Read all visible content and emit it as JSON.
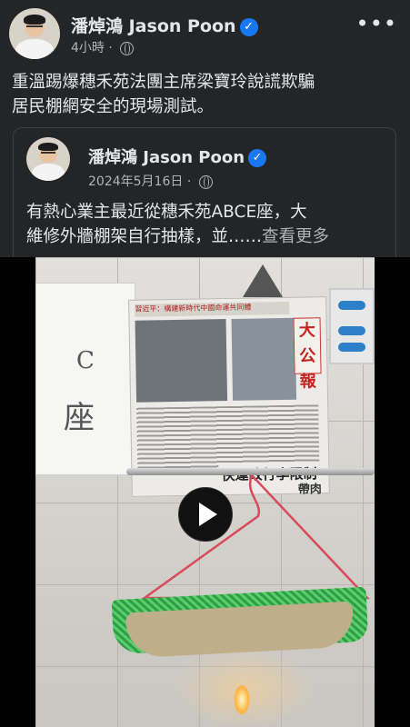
{
  "post": {
    "author": "潘焯鴻 Jason Poon",
    "verified_mark": "✓",
    "time": "4小時",
    "dot": "·",
    "more_label": "•••",
    "text_line1": "重溫踢爆￼穗禾苑法團主席梁寶玲說謊欺騙",
    "text_line2": "居民棚網安全的現場￼測試。"
  },
  "shared_post": {
    "author": "潘焯鴻 Jason Poon",
    "verified_mark": "✓",
    "date": "2024年5月16日",
    "dot": "·",
    "text_line1": "有熱心業主最近從￼穗禾苑ABCE座，大",
    "text_line2": "維修外牆棚架自行抽樣，並……",
    "see_more": "查看更多"
  },
  "video": {
    "paper_note_1": "C",
    "paper_note_2": "座",
    "newspaper_head": "習近平：構建新時代中國命運共同體",
    "newspaper_logo": "大公報",
    "newspaper_headline": "快運改行李限制",
    "newspaper_sub": "帶肉"
  },
  "colors": {
    "background": "#242526",
    "accent_verified": "#1877f2",
    "text_primary": "#e4e6eb",
    "text_secondary": "#b0b3b8"
  }
}
